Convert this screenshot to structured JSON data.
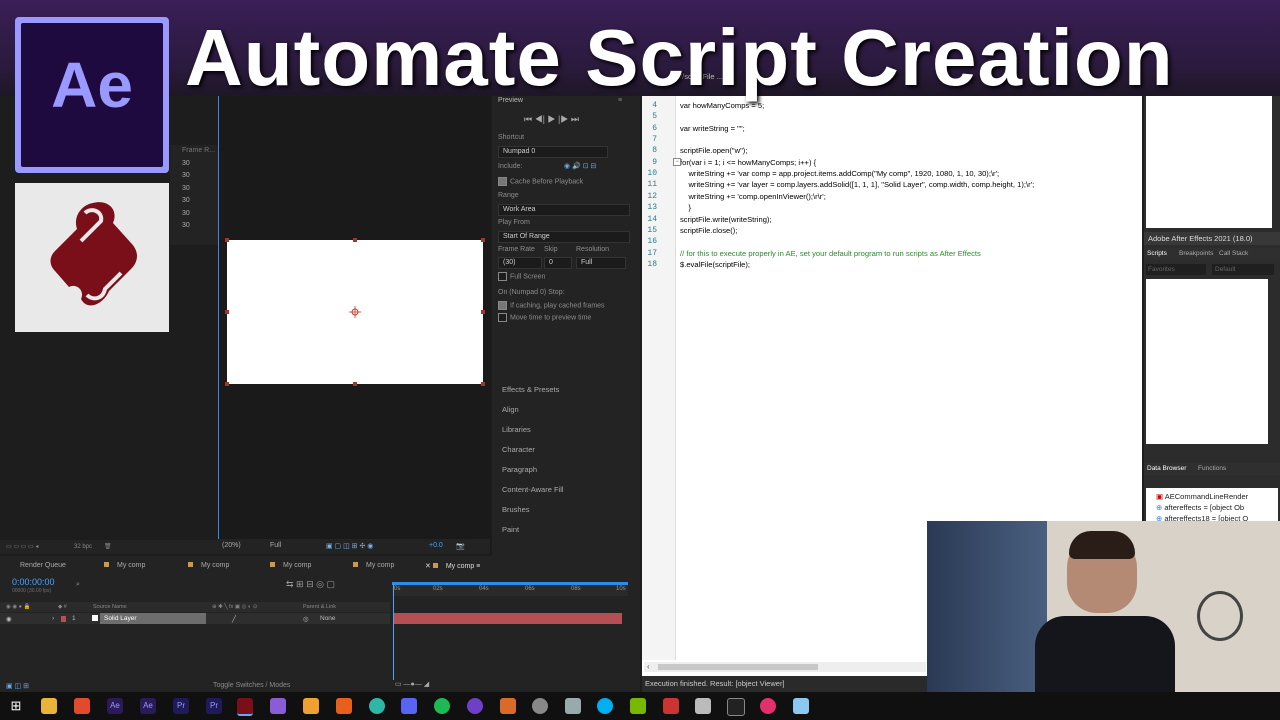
{
  "banner": {
    "title": "Automate Script Creation"
  },
  "logos": {
    "ae_text": "Ae"
  },
  "project": {
    "column_header": "Frame R...",
    "rows": [
      "30",
      "30",
      "30",
      "30",
      "30",
      "30"
    ]
  },
  "viewer": {
    "zoom": "(20%)",
    "resolution": "Full",
    "exposure": "+0.0",
    "bpc": "32 bpc"
  },
  "preview": {
    "title": "Preview",
    "shortcut_label": "Shortcut",
    "shortcut_value": "Numpad 0",
    "include_label": "Include:",
    "cache_before_playback": "Cache Before Playback",
    "range_label": "Range",
    "range_value": "Work Area",
    "play_from_label": "Play From",
    "play_from_value": "Start Of Range",
    "frame_rate_label": "Frame Rate",
    "skip_label": "Skip",
    "resolution_label": "Resolution",
    "frame_rate_value": "(30)",
    "skip_value": "0",
    "resolution_value": "Full",
    "full_screen": "Full Screen",
    "stop_label": "On (Numpad 0) Stop:",
    "if_caching": "If caching, play cached frames",
    "move_time": "Move time to preview time",
    "panels": [
      "Effects & Presets",
      "Align",
      "Libraries",
      "Character",
      "Paragraph",
      "Content-Aware Fill",
      "Brushes",
      "Paint"
    ]
  },
  "timeline": {
    "tabs": [
      "Render Queue",
      "My comp",
      "My comp",
      "My comp",
      "My comp",
      "My comp"
    ],
    "time": "0:00:00:00",
    "fps": "00000 (30.00 fps)",
    "ruler": [
      "0s",
      "02s",
      "04s",
      "06s",
      "08s",
      "10s"
    ],
    "col_source": "Source Name",
    "col_parent": "Parent & Link",
    "layer_num": "1",
    "layer_name": "Solid Layer",
    "layer_parent": "None",
    "footer": "Toggle Switches / Modes"
  },
  "editor": {
    "lines": [
      {
        "n": "4",
        "t": "var howManyComps = 5;"
      },
      {
        "n": "5",
        "t": ""
      },
      {
        "n": "6",
        "t": "var writeString = \"\";"
      },
      {
        "n": "7",
        "t": ""
      },
      {
        "n": "8",
        "t": "scriptFile.open(\"w\");"
      },
      {
        "n": "9",
        "t": "for(var i = 1; i <= howManyComps; i++) {"
      },
      {
        "n": "10",
        "t": "    writeString += 'var comp = app.project.items.addComp(\"My comp\", 1920, 1080, 1, 10, 30);\\r';"
      },
      {
        "n": "11",
        "t": "    writeString += 'var layer = comp.layers.addSolid([1, 1, 1], \"Solid Layer\", comp.width, comp.height, 1);\\r';"
      },
      {
        "n": "12",
        "t": "    writeString += 'comp.openInViewer();\\r\\r';"
      },
      {
        "n": "13",
        "t": "    }"
      },
      {
        "n": "14",
        "t": "scriptFile.write(writeString);"
      },
      {
        "n": "15",
        "t": "scriptFile.close();"
      },
      {
        "n": "16",
        "t": ""
      },
      {
        "n": "17",
        "t": "// for this to execute properly in AE, set your default program to run scripts as After Effects"
      },
      {
        "n": "18",
        "t": "$.evalFile(scriptFile);"
      }
    ],
    "status": "Execution finished. Result: [object Viewer]"
  },
  "estk": {
    "target": "Adobe After Effects 2021 (18.0)",
    "tabs": [
      "Scripts",
      "Breakpoints",
      "Call Stack"
    ],
    "favorites": "Favorites",
    "default": "Default",
    "tabs2": [
      "Data Browser",
      "Functions"
    ],
    "tree": [
      "AECommandLineRender",
      "aftereffects = [object Ob",
      "aftereffects18 = [object O"
    ]
  },
  "colors": {
    "ae_purple": "#9999ff",
    "ae_dark": "#1f0a40",
    "accent_blue": "#2d8ceb",
    "layer_bar": "#b45055",
    "script_red": "#7a0f1a"
  }
}
